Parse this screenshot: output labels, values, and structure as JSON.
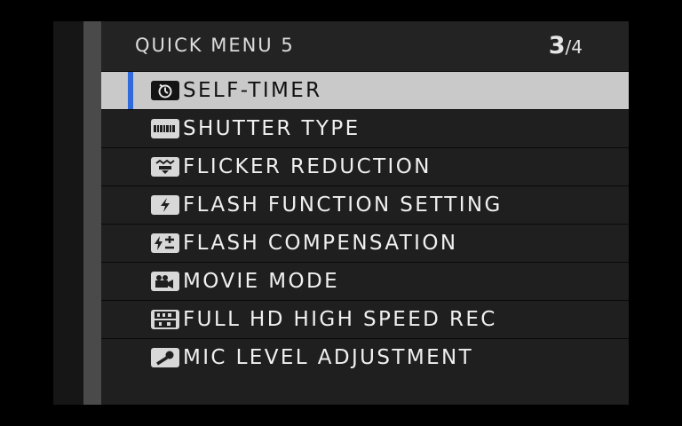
{
  "menu": {
    "title": "QUICK MENU 5",
    "page_current": "3",
    "page_separator": "/",
    "page_total": "4",
    "items": [
      {
        "label": "SELF-TIMER",
        "icon": "self-timer-icon",
        "selected": true
      },
      {
        "label": "SHUTTER TYPE",
        "icon": "shutter-type-icon",
        "selected": false
      },
      {
        "label": "FLICKER REDUCTION",
        "icon": "flicker-reduction-icon",
        "selected": false
      },
      {
        "label": "FLASH FUNCTION SETTING",
        "icon": "flash-icon",
        "selected": false
      },
      {
        "label": "FLASH COMPENSATION",
        "icon": "flash-compensation-icon",
        "selected": false
      },
      {
        "label": "MOVIE MODE",
        "icon": "movie-mode-icon",
        "selected": false
      },
      {
        "label": "FULL HD HIGH SPEED REC",
        "icon": "fhd-hs-icon",
        "selected": false
      },
      {
        "label": "MIC LEVEL ADJUSTMENT",
        "icon": "microphone-icon",
        "selected": false
      }
    ]
  },
  "colors": {
    "selection_marker": "#2f6bdc",
    "selected_row": "#c9c9c9"
  }
}
